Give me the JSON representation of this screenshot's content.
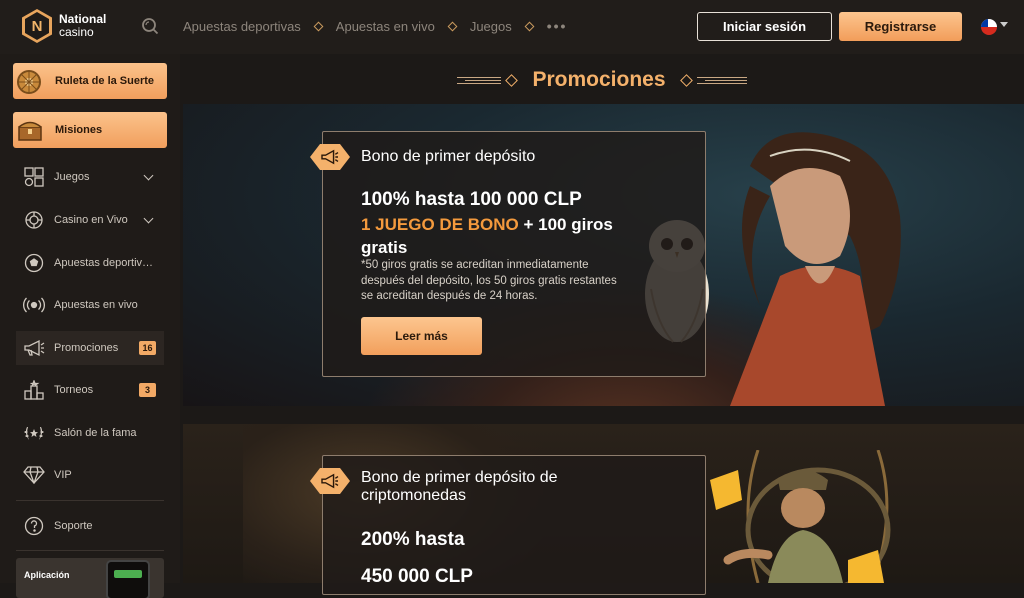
{
  "header": {
    "logo_line1": "National",
    "logo_line2": "casino",
    "logo_letter": "N",
    "nav": [
      "Apuestas deportivas",
      "Apuestas en vivo",
      "Juegos"
    ],
    "more": "•••",
    "login_label": "Iniciar sesión",
    "register_label": "Registrarse"
  },
  "sidebar": {
    "wheel_label": "Ruleta de la Suerte",
    "missions_label": "Misiones",
    "items": [
      {
        "label": "Juegos",
        "icon": "games-icon"
      },
      {
        "label": "Casino en Vivo",
        "icon": "live-casino-icon"
      },
      {
        "label": "Apuestas deportiv…",
        "icon": "soccer-ball-icon"
      },
      {
        "label": "Apuestas en vivo",
        "icon": "live-broadcast-icon"
      },
      {
        "label": "Promociones",
        "icon": "megaphone-icon",
        "badge": "16"
      },
      {
        "label": "Torneos",
        "icon": "tournament-icon",
        "badge": "3"
      },
      {
        "label": "Salón de la fama",
        "icon": "laurel-icon"
      },
      {
        "label": "VIP",
        "icon": "diamond-icon"
      },
      {
        "label": "Soporte",
        "icon": "help-icon"
      }
    ],
    "app_label": "Aplicación"
  },
  "page": {
    "title": "Promociones"
  },
  "promos": [
    {
      "title": "Bono de primer depósito",
      "line1": "100% hasta 100 000 CLP",
      "highlight": "1 JUEGO DE BONO",
      "line2_rest": " + 100 giros",
      "line3": "gratis",
      "note": "*50 giros gratis se acreditan inmediatamente después del depósito, los 50 giros gratis restantes se acreditan después de 24 horas.",
      "button": "Leer más"
    },
    {
      "title": "Bono de primer depósito de criptomonedas",
      "line1": "200% hasta",
      "line2": "450 000 CLP"
    }
  ],
  "colors": {
    "accent": "#f4b16b",
    "highlight": "#f49a3d",
    "background": "#1c1917"
  }
}
